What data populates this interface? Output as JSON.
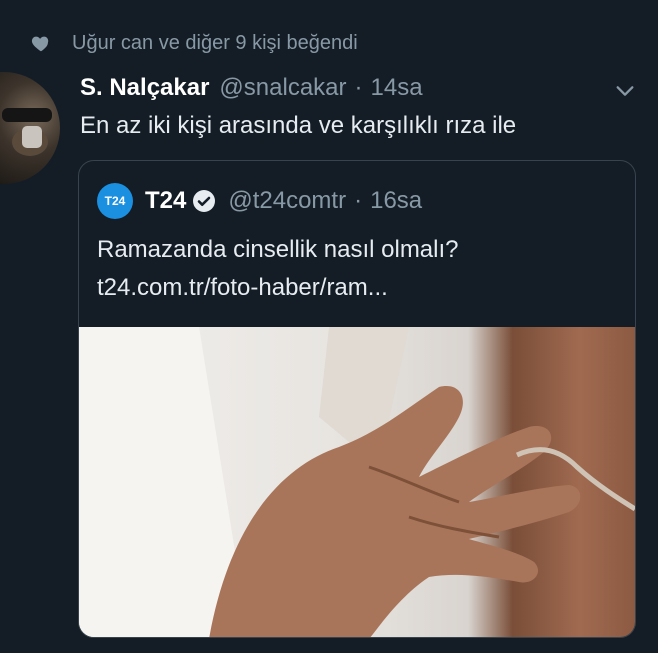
{
  "social_context": {
    "text": "Uğur can ve diğer 9 kişi beğendi",
    "icon": "heart-icon"
  },
  "tweet": {
    "name": "S. Nalçakar",
    "handle": "@snalcakar",
    "separator": "·",
    "time": "14sa",
    "text": "En az iki kişi arasında ve karşılıklı rıza ile"
  },
  "quoted_tweet": {
    "logo_text": "T24",
    "name": "T24",
    "handle": "@t24comtr",
    "separator": "·",
    "time": "16sa",
    "text": "Ramazanda cinsellik nasıl olmalı?",
    "link": "t24.com.tr/foto-haber/ram..."
  },
  "colors": {
    "background": "#141d26",
    "muted": "#8899a6",
    "accent": "#1b8fe0",
    "border": "#38444d"
  }
}
